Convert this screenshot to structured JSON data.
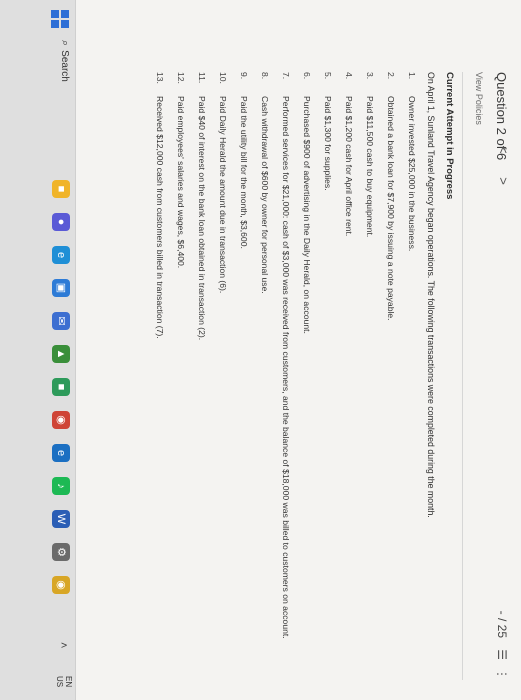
{
  "question": {
    "title": "Question 2 of 6",
    "nav": "< >",
    "score": "- / 25",
    "list_icon": "☰",
    "more_icon": "⋮",
    "view_policies": "View Policies"
  },
  "content": {
    "attempt_heading": "Current Attempt in Progress",
    "intro": "On April 1, Sunland Travel Agency began operations. The following transactions were completed during the month.",
    "transactions": [
      {
        "num": "1.",
        "text": "Owner invested $25,000 in the business."
      },
      {
        "num": "2.",
        "text": "Obtained a bank loan for $7,900 by issuing a note payable."
      },
      {
        "num": "3.",
        "text": "Paid $11,500 cash to buy equipment."
      },
      {
        "num": "4.",
        "text": "Paid $1,200 cash for April office rent."
      },
      {
        "num": "5.",
        "text": "Paid $1,300 for supplies."
      },
      {
        "num": "6.",
        "text": "Purchased $900 of advertising in the Daily Herald, on account."
      },
      {
        "num": "7.",
        "text": "Performed services for $21,000: cash of $3,000 was received from customers, and the balance of $18,000 was billed to customers on account."
      },
      {
        "num": "8.",
        "text": "Cash withdrawal of $600 by owner for personal use."
      },
      {
        "num": "9.",
        "text": "Paid the utility bill for the month, $3,600."
      },
      {
        "num": "10.",
        "text": "Paid Daily Herald the amount due in transaction (6)."
      },
      {
        "num": "11.",
        "text": "Paid $40 of interest on the bank loan obtained in transaction (2)."
      },
      {
        "num": "12.",
        "text": "Paid employees' salaries and wages, $6,400."
      },
      {
        "num": "13.",
        "text": "Received $12,000 cash from customers billed in transaction (7)."
      }
    ]
  },
  "taskbar": {
    "search_label": "Search",
    "language": "EN",
    "region": "US",
    "icons": [
      {
        "name": "file-explorer-icon",
        "glyph": "■",
        "color": "#f0b429"
      },
      {
        "name": "video-call-icon",
        "glyph": "●",
        "color": "#5a5ad6"
      },
      {
        "name": "edge-icon",
        "glyph": "e",
        "color": "#1f8fd6"
      },
      {
        "name": "store-icon",
        "glyph": "▣",
        "color": "#2d7bd6"
      },
      {
        "name": "mail-icon",
        "glyph": "✉",
        "color": "#3d6fd1"
      },
      {
        "name": "app-icon",
        "glyph": "▲",
        "color": "#3a8f3a"
      },
      {
        "name": "android-icon",
        "glyph": "■",
        "color": "#2d9a5a"
      },
      {
        "name": "chrome-icon",
        "glyph": "◉",
        "color": "#cf4436"
      },
      {
        "name": "edge-blue-icon",
        "glyph": "e",
        "color": "#1b6fc2"
      },
      {
        "name": "spotify-icon",
        "glyph": "♪",
        "color": "#1db954"
      },
      {
        "name": "word-icon",
        "glyph": "W",
        "color": "#2b5eb5"
      },
      {
        "name": "settings-icon",
        "glyph": "⚙",
        "color": "#6b6b6b"
      },
      {
        "name": "chrome-browser-icon",
        "glyph": "◉",
        "color": "#d8a625"
      }
    ]
  },
  "colors": {
    "page_bg": "#f4f3f1",
    "taskbar_bg": "#dfdfdf",
    "windows_blue": "#2f6fd6"
  }
}
